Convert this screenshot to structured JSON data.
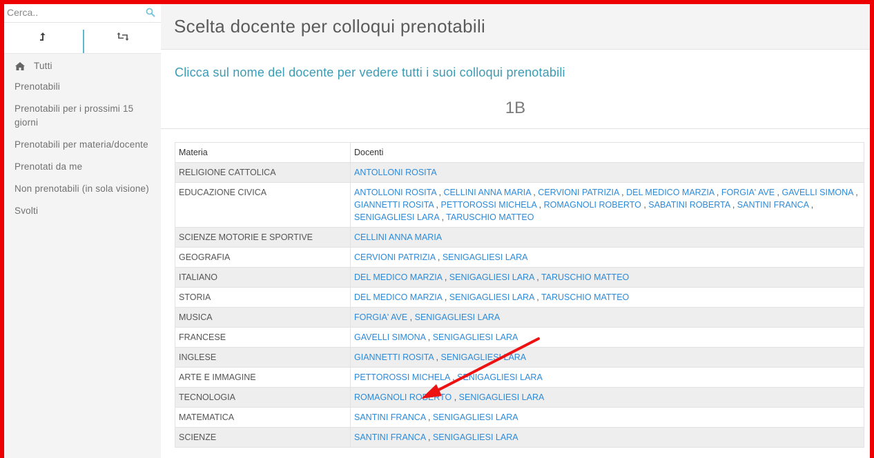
{
  "search": {
    "placeholder": "Cerca.."
  },
  "sidebar": {
    "items": [
      {
        "label": "Tutti",
        "icon": "home-icon"
      },
      {
        "label": "Prenotabili"
      },
      {
        "label": "Prenotabili per i prossimi 15 giorni"
      },
      {
        "label": "Prenotabili per materia/docente"
      },
      {
        "label": "Prenotati da me"
      },
      {
        "label": "Non prenotabili (in sola visione)"
      },
      {
        "label": "Svolti"
      }
    ]
  },
  "header": {
    "title": "Scelta docente per colloqui prenotabili"
  },
  "main": {
    "subtitle": "Clicca sul nome del docente per vedere tutti i suoi colloqui prenotabili",
    "class_label": "1B",
    "table": {
      "columns": [
        "Materia",
        "Docenti"
      ],
      "rows": [
        {
          "subject": "RELIGIONE CATTOLICA",
          "teachers": [
            "ANTOLLONI ROSITA"
          ]
        },
        {
          "subject": "EDUCAZIONE CIVICA",
          "teachers": [
            "ANTOLLONI ROSITA",
            "CELLINI ANNA MARIA",
            "CERVIONI PATRIZIA",
            "DEL MEDICO MARZIA",
            "FORGIA' AVE",
            "GAVELLI SIMONA",
            "GIANNETTI ROSITA",
            "PETTOROSSI MICHELA",
            "ROMAGNOLI ROBERTO",
            "SABATINI ROBERTA",
            "SANTINI FRANCA",
            "SENIGAGLIESI LARA",
            "TARUSCHIO MATTEO"
          ]
        },
        {
          "subject": "SCIENZE MOTORIE E SPORTIVE",
          "teachers": [
            "CELLINI ANNA MARIA"
          ]
        },
        {
          "subject": "GEOGRAFIA",
          "teachers": [
            "CERVIONI PATRIZIA",
            "SENIGAGLIESI LARA"
          ]
        },
        {
          "subject": "ITALIANO",
          "teachers": [
            "DEL MEDICO MARZIA",
            "SENIGAGLIESI LARA",
            "TARUSCHIO MATTEO"
          ]
        },
        {
          "subject": "STORIA",
          "teachers": [
            "DEL MEDICO MARZIA",
            "SENIGAGLIESI LARA",
            "TARUSCHIO MATTEO"
          ]
        },
        {
          "subject": "MUSICA",
          "teachers": [
            "FORGIA' AVE",
            "SENIGAGLIESI LARA"
          ]
        },
        {
          "subject": "FRANCESE",
          "teachers": [
            "GAVELLI SIMONA",
            "SENIGAGLIESI LARA"
          ]
        },
        {
          "subject": "INGLESE",
          "teachers": [
            "GIANNETTI ROSITA",
            "SENIGAGLIESI LARA"
          ]
        },
        {
          "subject": "ARTE E IMMAGINE",
          "teachers": [
            "PETTOROSSI MICHELA",
            "SENIGAGLIESI LARA"
          ]
        },
        {
          "subject": "TECNOLOGIA",
          "teachers": [
            "ROMAGNOLI ROBERTO",
            "SENIGAGLIESI LARA"
          ]
        },
        {
          "subject": "MATEMATICA",
          "teachers": [
            "SANTINI FRANCA",
            "SENIGAGLIESI LARA"
          ]
        },
        {
          "subject": "SCIENZE",
          "teachers": [
            "SANTINI FRANCA",
            "SENIGAGLIESI LARA"
          ]
        }
      ]
    }
  },
  "colors": {
    "frame": "#ee0000",
    "link": "#2d8ad8",
    "subtitle": "#3a9cb6",
    "sidebar_bg": "#f4f4f4",
    "annotation_arrow": "#ee1111"
  },
  "icons": {
    "search": "search-icon",
    "upload": "upload-icon",
    "retweet": "retweet-icon",
    "home": "home-icon",
    "annotation": "arrow-annotation"
  }
}
